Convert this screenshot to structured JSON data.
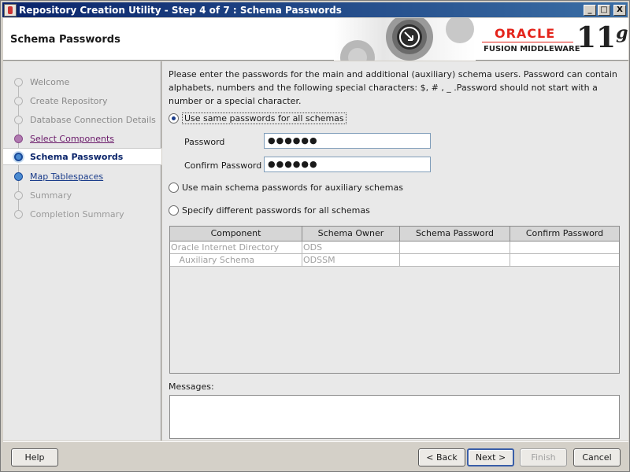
{
  "window": {
    "title": "Repository Creation Utility - Step 4 of 7 : Schema Passwords",
    "minimize_glyph": "_",
    "maximize_glyph": "□",
    "close_glyph": "X"
  },
  "header": {
    "page_title": "Schema Passwords",
    "logo_oracle": "ORACLE",
    "logo_fmw": "FUSION MIDDLEWARE",
    "logo_version": "11",
    "logo_version_g": "g"
  },
  "nav": {
    "items": [
      {
        "label": "Welcome",
        "state": "done"
      },
      {
        "label": "Create Repository",
        "state": "done"
      },
      {
        "label": "Database Connection Details",
        "state": "done"
      },
      {
        "label": "Select Components",
        "state": "visited"
      },
      {
        "label": "Schema Passwords",
        "state": "current"
      },
      {
        "label": "Map Tablespaces",
        "state": "link"
      },
      {
        "label": "Summary",
        "state": "pending"
      },
      {
        "label": "Completion Summary",
        "state": "pending"
      }
    ]
  },
  "main": {
    "intro": "Please enter the passwords for the main and additional (auxiliary) schema users. Password can contain alphabets, numbers and the following special characters: $, # , _ .Password should not start with a number or a special character.",
    "option_same": "Use same passwords for all schemas",
    "option_main": "Use main schema passwords for auxiliary schemas",
    "option_different": "Specify different passwords for all schemas",
    "selected_option": "option_same",
    "password_label": "Password",
    "password_value": "●●●●●●",
    "confirm_label": "Confirm Password",
    "confirm_value": "●●●●●●",
    "table": {
      "columns": [
        "Component",
        "Schema Owner",
        "Schema Password",
        "Confirm Password"
      ],
      "rows": [
        [
          "Oracle Internet Directory",
          "ODS",
          "",
          ""
        ],
        [
          "   Auxiliary Schema",
          "ODSSM",
          "",
          ""
        ]
      ]
    },
    "messages_label": "Messages:",
    "messages_text": ""
  },
  "footer": {
    "help": "Help",
    "back": "< Back",
    "next": "Next >",
    "finish": "Finish",
    "cancel": "Cancel"
  },
  "colors": {
    "titlebar_start": "#0a246a",
    "titlebar_end": "#3a6ea5",
    "oracle_red": "#e4241b",
    "current_step": "#0a246a"
  }
}
